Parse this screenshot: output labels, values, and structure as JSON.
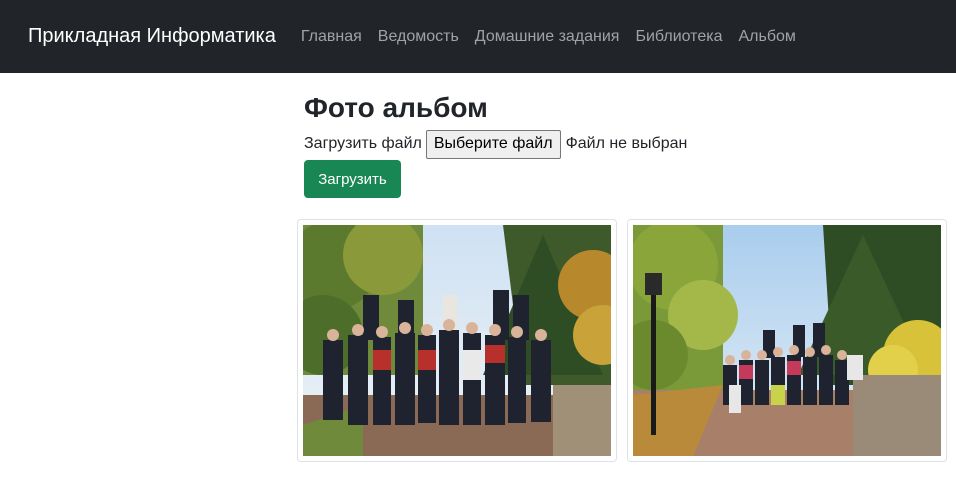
{
  "navbar": {
    "brand": "Прикладная Информатика",
    "links": [
      "Главная",
      "Ведомость",
      "Домашние задания",
      "Библиотека",
      "Альбом"
    ]
  },
  "page": {
    "title": "Фото альбом",
    "upload_label": "Загрузить файл",
    "file_button": "Выберите файл",
    "file_status": "Файл не выбран",
    "submit_label": "Загрузить"
  },
  "photos": [
    {
      "alt": ""
    },
    {
      "alt": ""
    }
  ],
  "colors": {
    "navbar_bg": "#212529",
    "nav_link": "#9fa3a7",
    "submit_bg": "#198754"
  }
}
